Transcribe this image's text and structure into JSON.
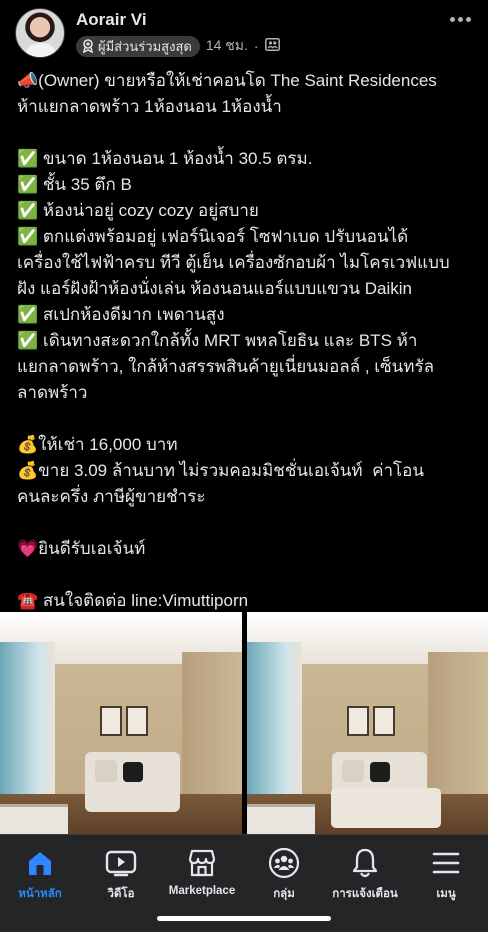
{
  "post": {
    "author": "Aorair Vi",
    "badge_label": "ผู้มีส่วนร่วมสูงสุด",
    "time": "14 ชม.",
    "separator": "·",
    "lines": [
      "📣(Owner) ขายหรือให้เช่าคอนโด The Saint Residences",
      "ห้าแยกลาดพร้าว 1ห้องนอน 1ห้องน้ำ",
      "",
      "✅ ขนาด 1ห้องนอน 1 ห้องน้ำ 30.5 ตรม.",
      "✅ ชั้น 35 ตึก B",
      "✅ ห้องน่าอยู่ cozy cozy อยู่สบาย",
      "✅ ตกแต่งพร้อมอยู่ เฟอร์นิเจอร์ โซฟาเบด ปรับนอนได้",
      "เครื่องใช้ไฟฟ้าครบ ทีวี ตู้เย็น เครื่องซักอบผ้า ไมโครเวฟแบบ",
      "ฝัง แอร์ฝังฝ้าห้องนั่งเล่น ห้องนอนแอร์แบบแขวน Daikin",
      "✅ สเปกห้องดีมาก เพดานสูง",
      "✅ เดินทางสะดวกใกล้ทั้ง MRT พหลโยธิน และ BTS ห้า",
      "แยกลาดพร้าว, ใกล้ห้างสรรพสินค้ายูเนี่ยนมอลล์ , เซ็นทรัล",
      "ลาดพร้าว",
      "",
      "💰ให้เช่า 16,000 บาท",
      "💰ขาย 3.09 ล้านบาท ไม่รวมคอมมิชชั่นเอเจ้นท์  ค่าโอน",
      "คนละครึ่ง ภาษีผู้ขายชำระ",
      "",
      "💗ยินดีรับเอเจ้นท์",
      "",
      "☎️ สนใจติดต่อ line:Vimuttiporn"
    ]
  },
  "tabs": [
    {
      "label": "หน้าหลัก",
      "icon": "home-icon",
      "active": true
    },
    {
      "label": "วิดีโอ",
      "icon": "video-icon",
      "active": false
    },
    {
      "label": "Marketplace",
      "icon": "marketplace-icon",
      "active": false
    },
    {
      "label": "กลุ่ม",
      "icon": "groups-icon",
      "active": false
    },
    {
      "label": "การแจ้งเตือน",
      "icon": "bell-icon",
      "active": false
    },
    {
      "label": "เมนู",
      "icon": "menu-icon",
      "active": false
    }
  ],
  "colors": {
    "background": "#000000",
    "tab_bar": "#242526",
    "accent": "#2d88ff",
    "text": "#e4e6eb",
    "secondary_text": "#b0b3b8"
  }
}
